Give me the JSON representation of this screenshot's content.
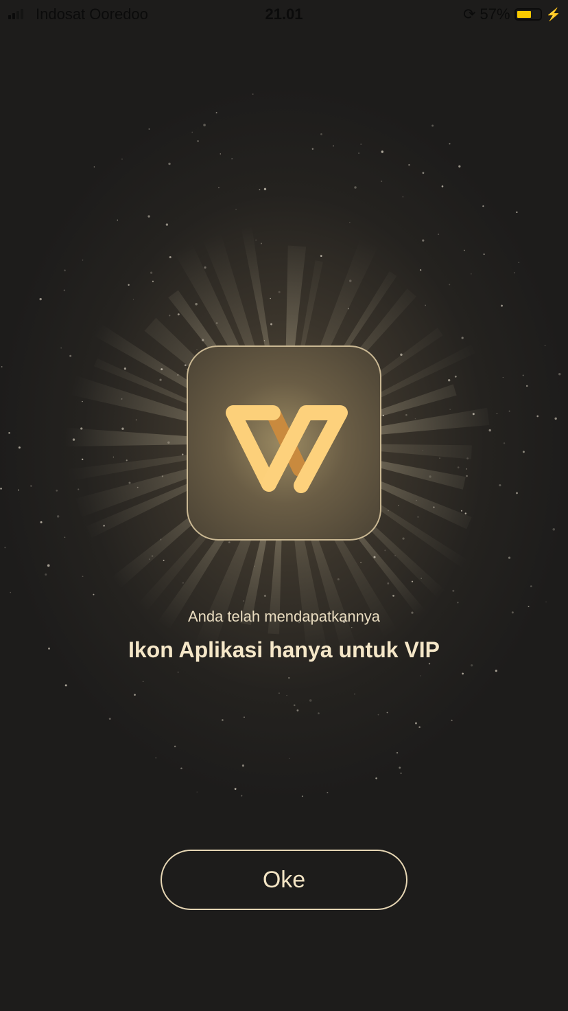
{
  "status_bar": {
    "carrier": "Indosat Ooredoo",
    "time": "21.01",
    "battery_percent": "57%",
    "battery_level": 0.57
  },
  "dialog": {
    "subtitle": "Anda telah mendapatkannya",
    "title": "Ikon Aplikasi hanya untuk VIP",
    "ok_label": "Oke"
  },
  "colors": {
    "accent": "#fcd07a",
    "accent_dark": "#c98a3e",
    "background": "#1d1c1b"
  }
}
